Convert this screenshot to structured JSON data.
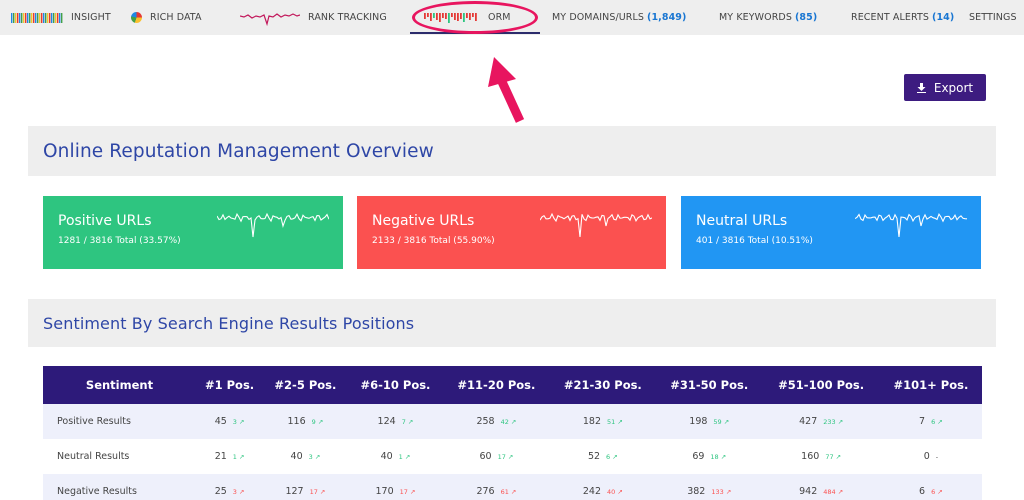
{
  "nav": {
    "insight": "INSIGHT",
    "rich_data": "RICH DATA",
    "rank_tracking": "RANK TRACKING",
    "orm": "ORM",
    "my_domains": "MY DOMAINS/URLS",
    "my_domains_count": "(1,849)",
    "my_keywords": "MY KEYWORDS",
    "my_keywords_count": "(85)",
    "recent_alerts": "RECENT ALERTS",
    "recent_alerts_count": "(14)",
    "settings": "SETTINGS"
  },
  "export_label": "Export",
  "overview_title": "Online Reputation Management Overview",
  "cards": [
    {
      "title": "Positive URLs",
      "sub": "1281 / 3816 Total (33.57%)",
      "color": "#2ec580"
    },
    {
      "title": "Negative URLs",
      "sub": "2133 / 3816 Total (55.90%)",
      "color": "#fb5150"
    },
    {
      "title": "Neutral URLs",
      "sub": "401 / 3816 Total (10.51%)",
      "color": "#2196f3"
    }
  ],
  "sentiment_title": "Sentiment By Search Engine Results Positions",
  "table": {
    "headers": [
      "Sentiment",
      "#1 Pos.",
      "#2-5 Pos.",
      "#6-10 Pos.",
      "#11-20 Pos.",
      "#21-30 Pos.",
      "#31-50 Pos.",
      "#51-100 Pos.",
      "#101+ Pos."
    ],
    "rows": [
      {
        "label": "Positive Results",
        "cells": [
          {
            "v": "45",
            "d": "3 ↗",
            "t": "up"
          },
          {
            "v": "116",
            "d": "9 ↗",
            "t": "up"
          },
          {
            "v": "124",
            "d": "7 ↗",
            "t": "up"
          },
          {
            "v": "258",
            "d": "42 ↗",
            "t": "up"
          },
          {
            "v": "182",
            "d": "51 ↗",
            "t": "up"
          },
          {
            "v": "198",
            "d": "59 ↗",
            "t": "up"
          },
          {
            "v": "427",
            "d": "233 ↗",
            "t": "up"
          },
          {
            "v": "7",
            "d": "6 ↗",
            "t": "up"
          }
        ]
      },
      {
        "label": "Neutral Results",
        "cells": [
          {
            "v": "21",
            "d": "1 ↗",
            "t": "up"
          },
          {
            "v": "40",
            "d": "3 ↗",
            "t": "up"
          },
          {
            "v": "40",
            "d": "1 ↗",
            "t": "up"
          },
          {
            "v": "60",
            "d": "17 ↗",
            "t": "up"
          },
          {
            "v": "52",
            "d": "6 ↗",
            "t": "up"
          },
          {
            "v": "69",
            "d": "18 ↗",
            "t": "up"
          },
          {
            "v": "160",
            "d": "77 ↗",
            "t": "up"
          },
          {
            "v": "0",
            "d": "-",
            "t": "flat"
          }
        ]
      },
      {
        "label": "Negative Results",
        "cells": [
          {
            "v": "25",
            "d": "3 ↗",
            "t": "down"
          },
          {
            "v": "127",
            "d": "17 ↗",
            "t": "down"
          },
          {
            "v": "170",
            "d": "17 ↗",
            "t": "down"
          },
          {
            "v": "276",
            "d": "61 ↗",
            "t": "down"
          },
          {
            "v": "242",
            "d": "40 ↗",
            "t": "down"
          },
          {
            "v": "382",
            "d": "133 ↗",
            "t": "down"
          },
          {
            "v": "942",
            "d": "484 ↗",
            "t": "down"
          },
          {
            "v": "6",
            "d": "6 ↗",
            "t": "down"
          }
        ]
      }
    ]
  }
}
